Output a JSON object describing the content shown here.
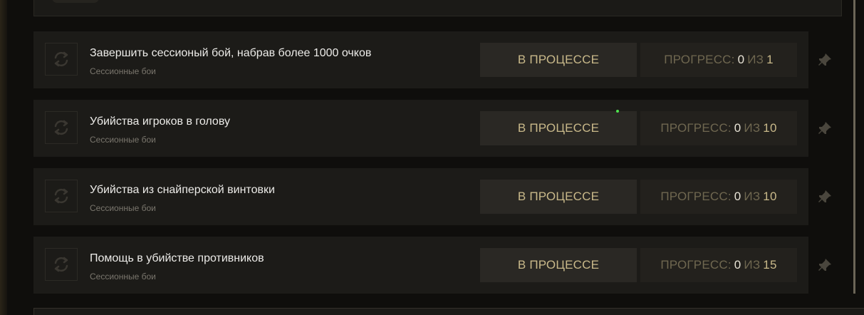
{
  "quests": [
    {
      "title": "Завершить сессионый бой, набрав более 1000 очков",
      "category": "Сессионные бои",
      "status": "В ПРОЦЕССЕ",
      "progress_label": "ПРОГРЕСС:",
      "progress_current": "0",
      "progress_sep": "ИЗ",
      "progress_total": "1"
    },
    {
      "title": "Убийства игроков в голову",
      "category": "Сессионные бои",
      "status": "В ПРОЦЕССЕ",
      "progress_label": "ПРОГРЕСС:",
      "progress_current": "0",
      "progress_sep": "ИЗ",
      "progress_total": "10"
    },
    {
      "title": "Убийства из снайперской винтовки",
      "category": "Сессионные бои",
      "status": "В ПРОЦЕССЕ",
      "progress_label": "ПРОГРЕСС:",
      "progress_current": "0",
      "progress_sep": "ИЗ",
      "progress_total": "10"
    },
    {
      "title": "Помощь в убийстве противников",
      "category": "Сессионные бои",
      "status": "В ПРОЦЕССЕ",
      "progress_label": "ПРОГРЕСС:",
      "progress_current": "0",
      "progress_sep": "ИЗ",
      "progress_total": "15"
    }
  ],
  "icons": {
    "quest_type": "refresh-icon",
    "pin": "pin-icon"
  },
  "colors": {
    "accent_gold": "#c9b98a",
    "progress_dim": "#6f6750",
    "row_bg": "#1c1b18",
    "page_bg": "#0f0e0c"
  }
}
